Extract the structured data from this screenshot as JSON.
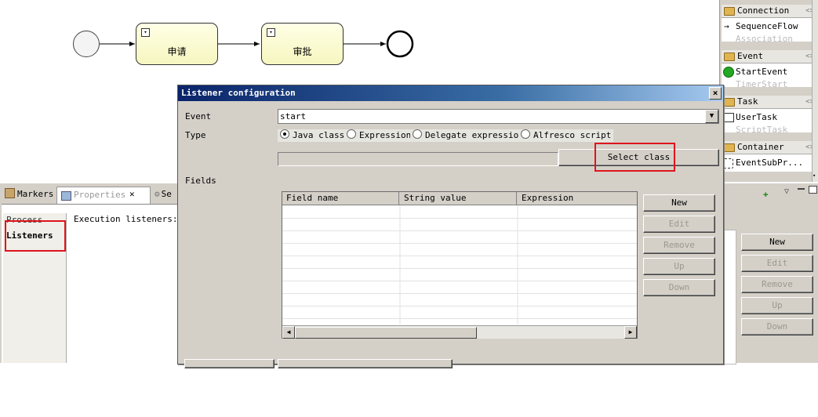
{
  "diagram": {
    "task1_label": "申请",
    "task2_label": "审批"
  },
  "palette": {
    "sections": [
      {
        "label": "Connection",
        "item": "SequenceFlow",
        "faded": "Association"
      },
      {
        "label": "Event",
        "item": "StartEvent",
        "faded": "TimerStart"
      },
      {
        "label": "Task",
        "item": "UserTask",
        "faded": "ScriptTask"
      },
      {
        "label": "Container",
        "item": "EventSubPr...",
        "faded": ""
      }
    ],
    "collapse_glyph": "<>"
  },
  "views": {
    "tab_markers": "Markers",
    "tab_properties": "Properties",
    "tab_third": "Se",
    "list_items": [
      "Process",
      "Listeners"
    ],
    "execution_label": "Execution listeners:"
  },
  "right_buttons": [
    "New",
    "Edit",
    "Remove",
    "Up",
    "Down"
  ],
  "dialog": {
    "title": "Listener configuration",
    "close": "×",
    "event_label": "Event",
    "event_value": "start",
    "type_label": "Type",
    "type_options": [
      "Java class",
      "Expression",
      "Delegate expression",
      "Alfresco script"
    ],
    "selected_type": "Java class",
    "select_class_button": "Select class",
    "fields_label": "Fields",
    "table_headers": [
      "Field name",
      "String value",
      "Expression"
    ],
    "buttons": [
      "New",
      "Edit",
      "Remove",
      "Up",
      "Down"
    ]
  },
  "colors": {
    "highlight": "#e0141c",
    "title_bar": "#0a246a",
    "task_fill": "#ffffe6"
  }
}
